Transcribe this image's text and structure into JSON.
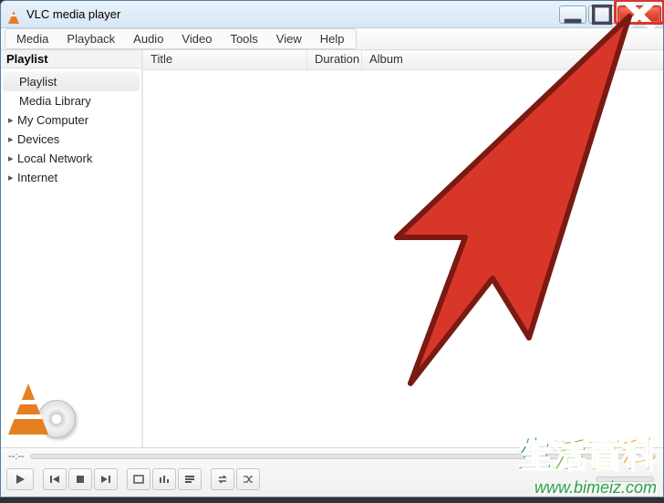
{
  "window": {
    "title": "VLC media player"
  },
  "window_controls": {
    "minimize": "—",
    "maximize": "❐",
    "close": "✕"
  },
  "menubar": {
    "media": "Media",
    "playback": "Playback",
    "audio": "Audio",
    "video": "Video",
    "tools": "Tools",
    "view": "View",
    "help": "Help"
  },
  "sidebar": {
    "header": "Playlist",
    "items": [
      {
        "label": "Playlist",
        "expandable": false,
        "indent": true,
        "selected": true
      },
      {
        "label": "Media Library",
        "expandable": false,
        "indent": true,
        "selected": false
      },
      {
        "label": "My Computer",
        "expandable": true,
        "indent": false,
        "selected": false
      },
      {
        "label": "Devices",
        "expandable": true,
        "indent": false,
        "selected": false
      },
      {
        "label": "Local Network",
        "expandable": true,
        "indent": false,
        "selected": false
      },
      {
        "label": "Internet",
        "expandable": true,
        "indent": false,
        "selected": false
      }
    ]
  },
  "columns": {
    "title": "Title",
    "duration": "Duration",
    "album": "Album"
  },
  "footer": {
    "time": "--:--"
  },
  "watermark": {
    "cn": "生活百科",
    "url": "www.bimeiz.com"
  }
}
